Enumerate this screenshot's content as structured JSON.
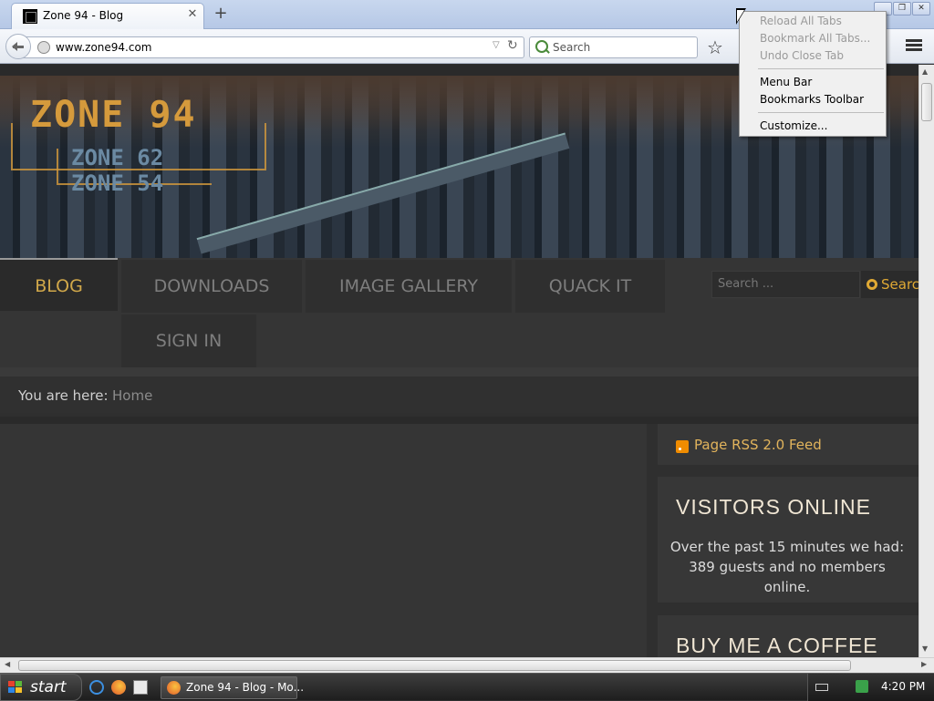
{
  "browser": {
    "tab_title": "Zone 94 - Blog",
    "tab_close": "✕",
    "new_tab": "+",
    "url": "www.zone94.com",
    "search_placeholder": "Search",
    "star": "☆",
    "win_min": "_",
    "win_restore": "❐",
    "win_close": "✕"
  },
  "context_menu": {
    "items": [
      {
        "label": "Reload All Tabs",
        "enabled": false
      },
      {
        "label": "Bookmark All Tabs...",
        "enabled": false
      },
      {
        "label": "Undo Close Tab",
        "enabled": false
      },
      {
        "label": "Menu Bar",
        "enabled": true
      },
      {
        "label": "Bookmarks Toolbar",
        "enabled": true
      },
      {
        "label": "Customize...",
        "enabled": true
      }
    ]
  },
  "site": {
    "logo_main": "ZONE 94",
    "logo_sub1": "ZONE 62",
    "logo_sub2": "ZONE 54",
    "nav": [
      "BLOG",
      "DOWNLOADS",
      "IMAGE GALLERY",
      "QUACK IT",
      "SIGN IN"
    ],
    "active_nav": "BLOG",
    "search_placeholder": "Search ...",
    "search_button": "Search",
    "breadcrumb_label": "You are here:",
    "breadcrumb_home": "Home",
    "rss_label": "Page RSS 2.0 Feed",
    "visitors_title": "VISITORS ONLINE",
    "visitors_text": "Over the past 15 minutes we had: 389 guests and no members online.",
    "coffee_title": "BUY ME A COFFEE"
  },
  "taskbar": {
    "start": "start",
    "task_label": "Zone 94 - Blog - Mo...",
    "clock": "4:20 PM"
  },
  "colors": {
    "accent_gold": "#d1a84a",
    "rss_orange": "#f08c00"
  }
}
